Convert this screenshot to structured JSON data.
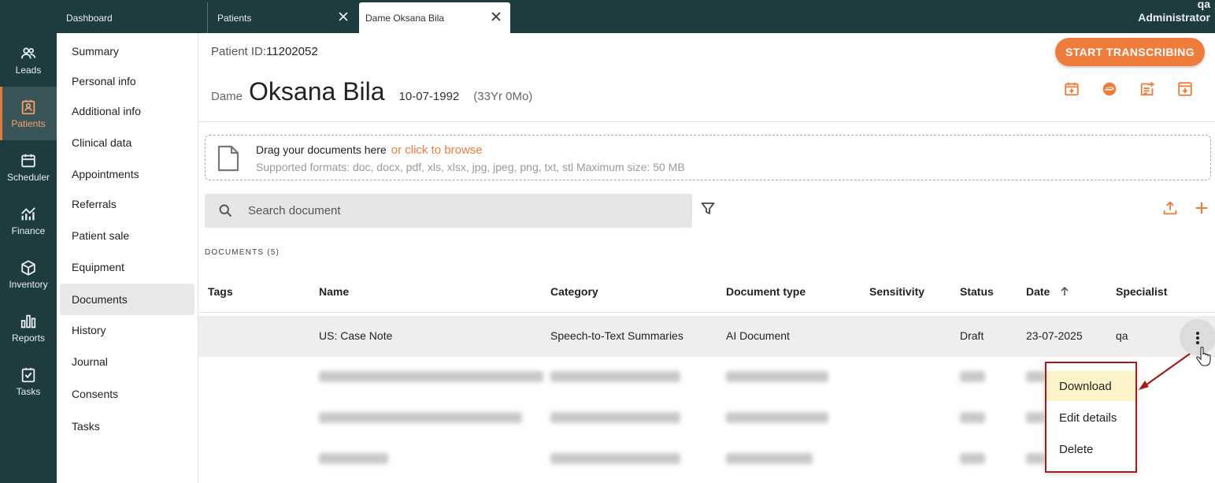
{
  "tabs": [
    {
      "label": "Dashboard"
    },
    {
      "label": "Patients"
    },
    {
      "label": "Dame Oksana Bila"
    }
  ],
  "user": {
    "line1": "qa",
    "line2": "Administrator"
  },
  "rail": [
    {
      "label": "Leads",
      "icon": "people-icon"
    },
    {
      "label": "Patients",
      "icon": "patient-card-icon"
    },
    {
      "label": "Scheduler",
      "icon": "calendar-icon"
    },
    {
      "label": "Finance",
      "icon": "finance-chart-icon"
    },
    {
      "label": "Inventory",
      "icon": "box-icon"
    },
    {
      "label": "Reports",
      "icon": "bar-chart-icon"
    },
    {
      "label": "Tasks",
      "icon": "checklist-icon"
    }
  ],
  "subnav": [
    {
      "label": "Summary"
    },
    {
      "label": "Personal info"
    },
    {
      "label": "Additional info"
    },
    {
      "label": "Clinical data"
    },
    {
      "label": "Appointments"
    },
    {
      "label": "Referrals"
    },
    {
      "label": "Patient sale"
    },
    {
      "label": "Equipment"
    },
    {
      "label": "Documents"
    },
    {
      "label": "History"
    },
    {
      "label": "Journal"
    },
    {
      "label": "Consents"
    },
    {
      "label": "Tasks"
    }
  ],
  "patient": {
    "id_label": "Patient ID:",
    "id": "11202052",
    "prefix": "Dame",
    "name": "Oksana Bila",
    "dob": "10-07-1992",
    "age": "(33Yr 0Mo)"
  },
  "start_button": "START TRANSCRIBING",
  "upload": {
    "text": "Drag your documents here",
    "browse": "or click to browse",
    "formats": "Supported formats: doc, docx, pdf, xls, xlsx, jpg, jpeg, png, txt, stl  Maximum size: 50 MB"
  },
  "search": {
    "placeholder": "Search document"
  },
  "documents_count": "DOCUMENTS (5)",
  "table": {
    "headers": [
      "Tags",
      "Name",
      "Category",
      "Document type",
      "Sensitivity",
      "Status",
      "Date",
      "Specialist"
    ],
    "rows": [
      {
        "tags": "",
        "name": "US: Case Note",
        "category": "Speech-to-Text Summaries",
        "doc_type": "AI Document",
        "sensitivity": "",
        "status": "Draft",
        "date": "23-07-2025",
        "specialist": "qa"
      }
    ]
  },
  "context_menu": [
    "Download",
    "Edit details",
    "Delete"
  ],
  "colors": {
    "sidebar": "#1e3b3e",
    "accent": "#f07c3c",
    "annotation": "#a31b1b",
    "highlight": "#fdf3c9"
  }
}
